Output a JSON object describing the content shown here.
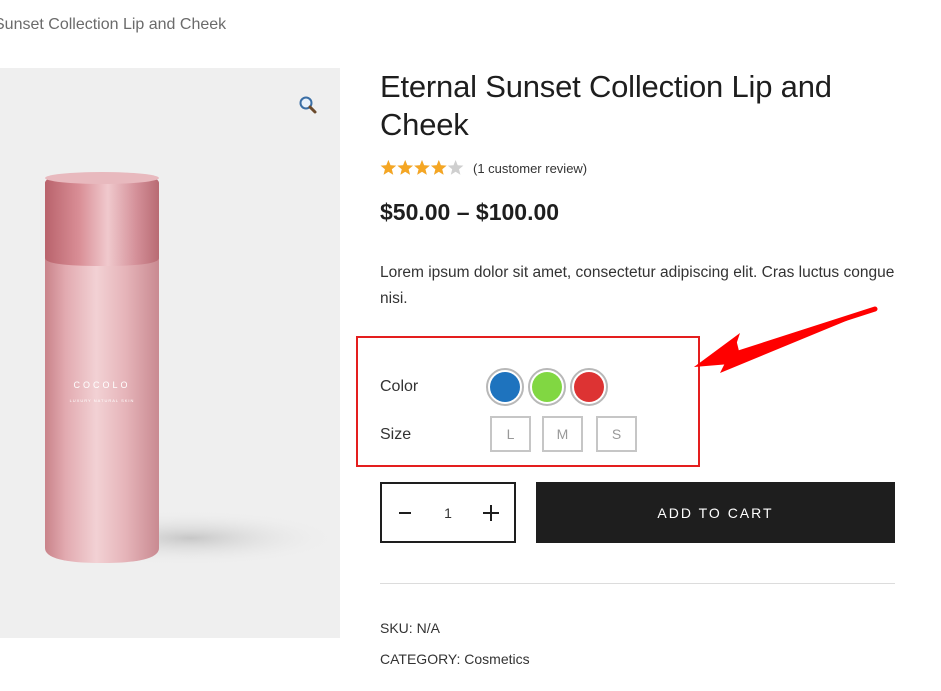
{
  "breadcrumb": {
    "current": "Sunset Collection Lip and Cheek"
  },
  "product": {
    "title": "Eternal Sunset Collection Lip and Cheek",
    "rating": {
      "value": 4,
      "max": 5,
      "review_text": "(1 customer review)"
    },
    "price": "$50.00 – $100.00",
    "description": "Lorem ipsum dolor sit amet, consectetur adipiscing elit. Cras luctus congue nisi.",
    "image": {
      "brand": "COCOLO",
      "tagline": "LUXURY NATURAL SKIN"
    }
  },
  "variations": {
    "color_label": "Color",
    "colors": [
      {
        "name": "blue",
        "hex": "#1e73be"
      },
      {
        "name": "green",
        "hex": "#81d742"
      },
      {
        "name": "red",
        "hex": "#dd3333"
      }
    ],
    "size_label": "Size",
    "sizes": [
      "L",
      "M",
      "S"
    ]
  },
  "cart": {
    "quantity": "1",
    "add_to_cart_label": "ADD TO CART"
  },
  "meta": {
    "sku_label": "SKU:",
    "sku_value": "N/A",
    "category_label": "CATEGORY:",
    "category_value": "Cosmetics"
  },
  "colors": {
    "highlight_box": "#e41e1e",
    "star": "#f5a623",
    "button_bg": "#1e1e1e"
  },
  "icons": {
    "zoom": "magnifier-icon",
    "minus": "minus-icon",
    "plus": "plus-icon",
    "annotation": "arrow-icon"
  }
}
